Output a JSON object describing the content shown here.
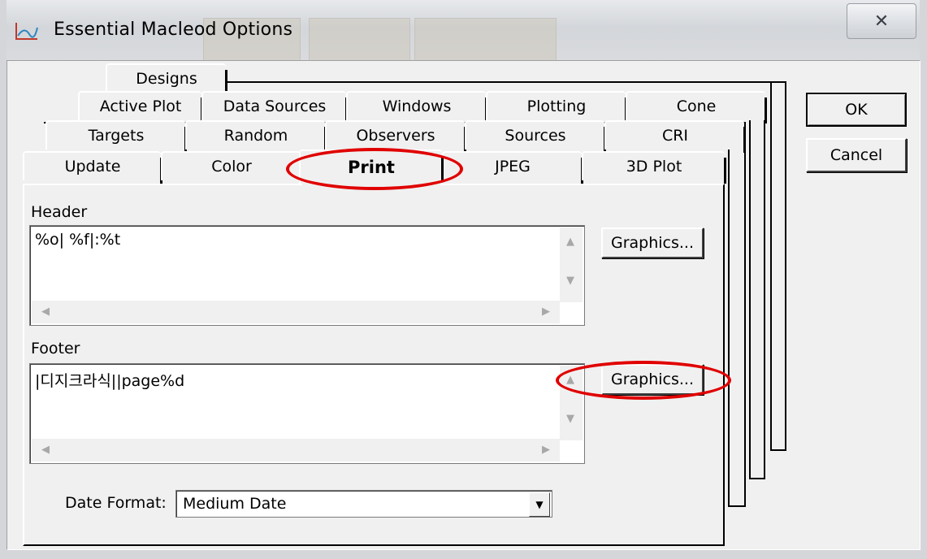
{
  "window": {
    "title": "Essential Macleod Options",
    "close_glyph": "✕"
  },
  "tabs": {
    "row1": [
      {
        "label": "Designs"
      }
    ],
    "row2": [
      {
        "label": "Active Plot"
      },
      {
        "label": "Data Sources"
      },
      {
        "label": "Windows"
      },
      {
        "label": "Plotting"
      },
      {
        "label": "Cone"
      }
    ],
    "row3": [
      {
        "label": "Targets"
      },
      {
        "label": "Random"
      },
      {
        "label": "Observers"
      },
      {
        "label": "Sources"
      },
      {
        "label": "CRI"
      }
    ],
    "row4": [
      {
        "label": "Update"
      },
      {
        "label": "Color"
      },
      {
        "label": "Print"
      },
      {
        "label": "JPEG"
      },
      {
        "label": "3D Plot"
      }
    ],
    "active": "Print"
  },
  "print_page": {
    "header": {
      "label": "Header",
      "value": "%o| %f|:%t",
      "graphics_button": "Graphics..."
    },
    "footer": {
      "label": "Footer",
      "value": "|디지크라식||page%d",
      "graphics_button": "Graphics..."
    },
    "date_format": {
      "label": "Date Format:",
      "value": "Medium Date"
    }
  },
  "buttons": {
    "ok": "OK",
    "cancel": "Cancel"
  },
  "icons": {
    "app": "macleod-app-icon",
    "scroll_up": "▲",
    "scroll_down": "▼",
    "scroll_left": "◀",
    "scroll_right": "▶",
    "dropdown": "▼"
  },
  "colors": {
    "highlight_oval": "#e00000"
  }
}
